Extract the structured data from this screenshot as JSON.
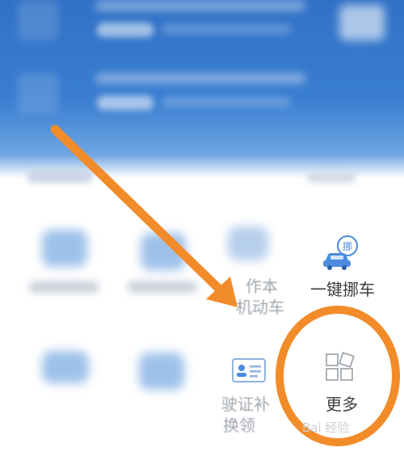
{
  "grid": {
    "move_car_label": "一键挪车",
    "register_label_line1": "作本",
    "register_label_line2": "机动车",
    "license_label_line1": "驶证补",
    "license_label_line2": "换领",
    "more_label": "更多"
  },
  "move_car_badge": "挪",
  "watermark": "Bai 经验",
  "colors": {
    "banner_blue": "#3a7ed1",
    "arrow_orange": "#f28c2a",
    "circle_orange": "#f28c2a",
    "icon_blue": "#4a8be0"
  },
  "icons": {
    "move_car": "car-move-icon",
    "license": "license-card-icon",
    "more": "more-grid-icon",
    "annotation": "orange-arrow"
  }
}
